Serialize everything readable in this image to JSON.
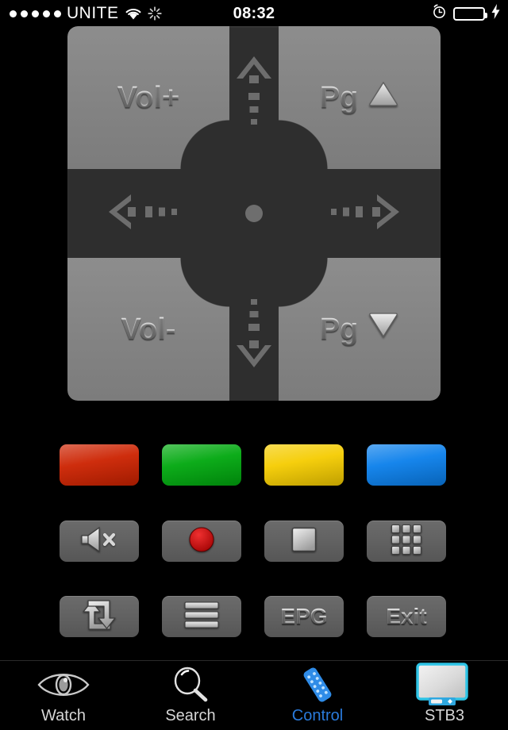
{
  "statusbar": {
    "signal_dots": 5,
    "carrier": "UNITE",
    "wifi_icon": "wifi-icon",
    "activity_icon": "activity-spinner-icon",
    "time": "08:32",
    "alarm_icon": "alarm-clock-icon",
    "battery_icon": "battery-icon",
    "battery_level": "100",
    "battery_color": "#3ad63a",
    "charging": true
  },
  "dpad": {
    "vol_up_label": "Vol+",
    "vol_down_label": "Vol-",
    "page_up_label": "Pg",
    "page_down_label": "Pg",
    "page_up_glyph": "triangle-up-icon",
    "page_down_glyph": "triangle-down-icon",
    "up_icon": "arrow-up-icon",
    "down_icon": "arrow-down-icon",
    "left_icon": "arrow-left-icon",
    "right_icon": "arrow-right-icon",
    "ok_icon": "ok-center-button",
    "panel_color": "#2e2e2e",
    "quadrant_color": "#858585"
  },
  "color_buttons": [
    {
      "name": "red-button",
      "color": "#cc2200"
    },
    {
      "name": "green-button",
      "color": "#00a80e"
    },
    {
      "name": "yellow-button",
      "color": "#f5cc00"
    },
    {
      "name": "blue-button",
      "color": "#0a7feb"
    }
  ],
  "row2": [
    {
      "name": "mute-button",
      "icon": "speaker-mute-icon",
      "label": ""
    },
    {
      "name": "record-button",
      "icon": "record-circle-icon",
      "label": ""
    },
    {
      "name": "stop-button",
      "icon": "stop-square-icon",
      "label": ""
    },
    {
      "name": "keypad-button",
      "icon": "numeric-keypad-icon",
      "label": ""
    }
  ],
  "row3": [
    {
      "name": "swap-button",
      "icon": "swap-arrows-icon",
      "label": ""
    },
    {
      "name": "menu-button",
      "icon": "menu-bars-icon",
      "label": ""
    },
    {
      "name": "epg-button",
      "icon": "",
      "label": "EPG"
    },
    {
      "name": "exit-button",
      "icon": "",
      "label": "Exit"
    }
  ],
  "tabs": [
    {
      "label": "Watch",
      "icon": "eye-icon",
      "active": false
    },
    {
      "label": "Search",
      "icon": "search-icon",
      "active": false
    },
    {
      "label": "Control",
      "icon": "remote-control-icon",
      "active": true
    },
    {
      "label": "STB3",
      "icon": "set-top-box-icon",
      "active": false
    }
  ],
  "accent_color": "#2a7bdc",
  "stb_icon_color": "#2ec4e6"
}
